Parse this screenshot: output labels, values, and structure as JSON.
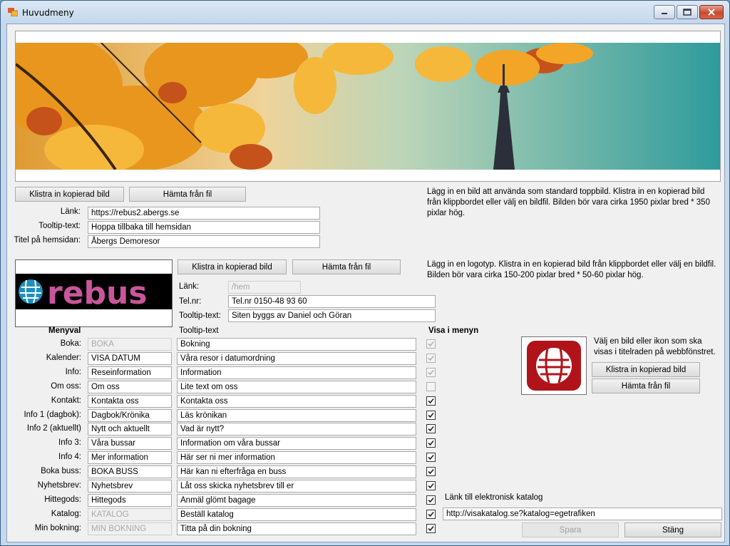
{
  "window": {
    "title": "Huvudmeny"
  },
  "banner": {
    "paste_button": "Klistra in kopierad bild",
    "file_button": "Hämta från fil",
    "info": "Lägg in en bild att använda som standard toppbild. Klistra in en kopierad bild från klippbordet eller välj en bildfil. Bilden bör vara cirka 1950 pixlar bred * 350 pixlar hög.",
    "link_label": "Länk:",
    "link_value": "https://rebus2.abergs.se",
    "tooltip_label": "Tooltip-text:",
    "tooltip_value": "Hoppa tillbaka till hemsidan",
    "pagetitle_label": "Titel på hemsidan:",
    "pagetitle_value": "Åbergs Demoresor"
  },
  "logo": {
    "paste_button": "Klistra in kopierad bild",
    "file_button": "Hämta från fil",
    "info": "Lägg in en logotyp. Klistra in en kopierad bild från klippbordet eller välj en bildfil. Bilden bör vara cirka 150-200 pixlar bred * 50-60 pixlar hög.",
    "link_label": "Länk:",
    "link_value": "/hem",
    "tel_label": "Tel.nr:",
    "tel_value": "Tel.nr 0150-48 93 60",
    "tooltip_label": "Tooltip-text:",
    "tooltip_value": "Siten byggs av Daniel och Göran",
    "logo_text": "rebus"
  },
  "menu": {
    "header_menyval": "Menyval",
    "header_tooltip": "Tooltip-text",
    "header_visa": "Visa i menyn",
    "rows": [
      {
        "label": "Boka:",
        "value": "BOKA",
        "tooltip": "Bokning",
        "checked": true,
        "disabled": true
      },
      {
        "label": "Kalender:",
        "value": "VISA DATUM",
        "tooltip": "Våra resor i datumordning",
        "checked": true,
        "disabled": true
      },
      {
        "label": "Info:",
        "value": "Reseinformation",
        "tooltip": "Information",
        "checked": true,
        "disabled": true
      },
      {
        "label": "Om oss:",
        "value": "Om oss",
        "tooltip": "Lite text om oss",
        "checked": false,
        "disabled": true
      },
      {
        "label": "Kontakt:",
        "value": "Kontakta oss",
        "tooltip": "Kontakta oss",
        "checked": true,
        "disabled": false
      },
      {
        "label": "Info 1 (dagbok):",
        "value": "Dagbok/Krönika",
        "tooltip": "Läs krönikan",
        "checked": true,
        "disabled": false
      },
      {
        "label": "Info 2 (aktuellt)",
        "value": "Nytt och aktuellt",
        "tooltip": "Vad är nytt?",
        "checked": true,
        "disabled": false
      },
      {
        "label": "Info 3:",
        "value": "Våra bussar",
        "tooltip": "Information om våra bussar",
        "checked": true,
        "disabled": false
      },
      {
        "label": "Info 4:",
        "value": "Mer information",
        "tooltip": "Här ser ni mer information",
        "checked": true,
        "disabled": false
      },
      {
        "label": "Boka buss:",
        "value": "BOKA BUSS",
        "tooltip": "Här kan ni efterfråga en buss",
        "checked": true,
        "disabled": false
      },
      {
        "label": "Nyhetsbrev:",
        "value": "Nyhetsbrev",
        "tooltip": "Låt oss skicka nyhetsbrev till er",
        "checked": true,
        "disabled": false
      },
      {
        "label": "Hittegods:",
        "value": "Hittegods",
        "tooltip": "Anmäl glömt bagage",
        "checked": true,
        "disabled": false
      },
      {
        "label": "Katalog:",
        "value": "KATALOG",
        "tooltip": "Beställ katalog",
        "checked": true,
        "disabled": false
      },
      {
        "label": "Min bokning:",
        "value": "MIN BOKNING",
        "tooltip": "Titta på din bokning",
        "checked": true,
        "disabled": false
      }
    ]
  },
  "favicon": {
    "info": "Välj en bild eller ikon som ska visas i titelraden på webbfönstret.",
    "paste_button": "Klistra in kopierad bild",
    "file_button": "Hämta från fil"
  },
  "catalog": {
    "label": "Länk till elektronisk katalog",
    "value": "http://visakatalog.se?katalog=egetrafiken"
  },
  "footer": {
    "save_button": "Spara",
    "close_button": "Stäng"
  },
  "colors": {
    "logo_pink": "#c8569a",
    "logo_globe": "#1f8fbf",
    "favicon_red": "#b0141a"
  }
}
